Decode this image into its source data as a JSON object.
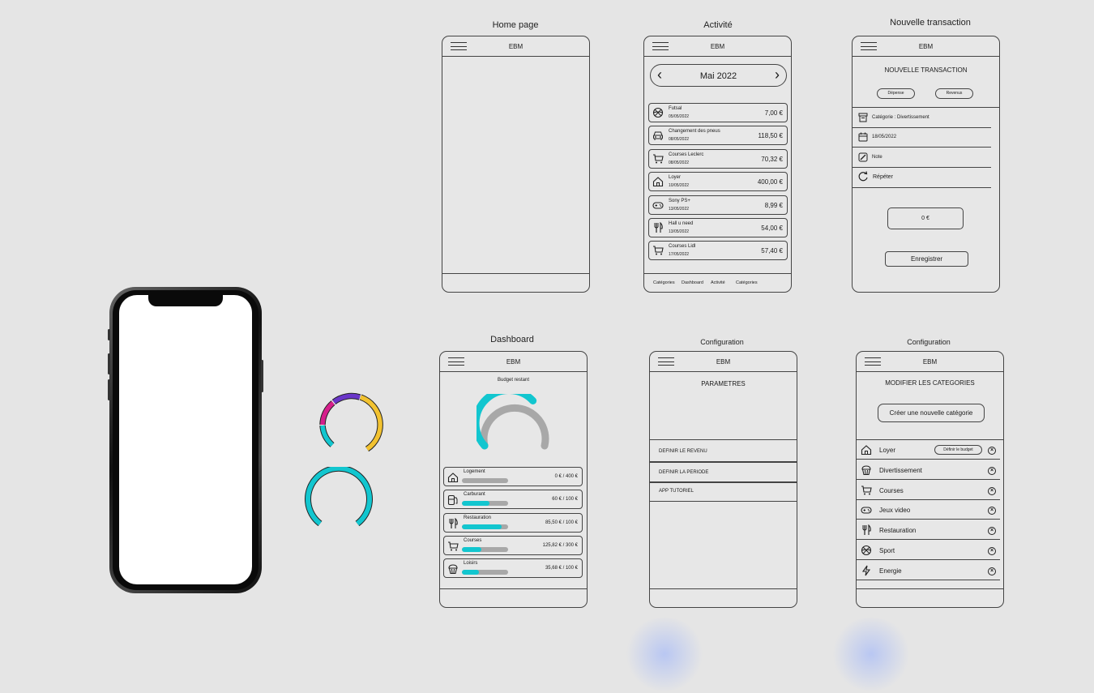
{
  "titles": {
    "home": "Home page",
    "activite": "Activité",
    "transaction": "Nouvelle transaction",
    "dashboard": "Dashboard",
    "config1": "Configuration",
    "config2": "Configuration"
  },
  "app_name": "EBM",
  "activity": {
    "month": "Mai 2022",
    "items": [
      {
        "icon": "basketball-icon",
        "name": "Futsal",
        "date": "05/05/2022",
        "amount": "7,00 €"
      },
      {
        "icon": "car-icon",
        "name": "Changement des pneus",
        "date": "08/05/2022",
        "amount": "118,50 €"
      },
      {
        "icon": "cart-icon",
        "name": "Courses Leclerc",
        "date": "08/05/2022",
        "amount": "70,32 €"
      },
      {
        "icon": "house-icon",
        "name": "Loyer",
        "date": "10/05/2022",
        "amount": "400,00 €"
      },
      {
        "icon": "gamepad-icon",
        "name": "Sony PS+",
        "date": "13/05/2022",
        "amount": "8,99 €"
      },
      {
        "icon": "cutlery-icon",
        "name": "Hall u need",
        "date": "13/05/2022",
        "amount": "54,00 €"
      },
      {
        "icon": "cart-icon",
        "name": "Courses Lidl",
        "date": "17/05/2022",
        "amount": "57,40 €"
      }
    ],
    "nav": [
      "Catégories",
      "Dashboard",
      "Activité",
      "Catégories"
    ]
  },
  "transaction": {
    "heading": "NOUVELLE TRANSACTION",
    "type_expense": "Dépense",
    "type_income": "Revenus",
    "category": "Catégorie : Divertissement",
    "date": "18/05/2022",
    "note": "Note",
    "repeat": "Répéter",
    "amount": "0 €",
    "save": "Enregistrer"
  },
  "dashboard": {
    "budget_label": "Budget restant",
    "gauge_fraction": 0.55,
    "accent": "#12c6cf",
    "items": [
      {
        "icon": "house-icon",
        "name": "Logement",
        "value": "0 €  /  400 €",
        "fraction": 0.0
      },
      {
        "icon": "fuel-icon",
        "name": "Carburant",
        "value": "60 €  /  100 €",
        "fraction": 0.6
      },
      {
        "icon": "cutlery-icon",
        "name": "Restauration",
        "value": "85,50 €  /  100 €",
        "fraction": 0.855
      },
      {
        "icon": "cart-icon",
        "name": "Courses",
        "value": "125,82 €  /  300 €",
        "fraction": 0.42
      },
      {
        "icon": "cupcake-icon",
        "name": "Loisirs",
        "value": "35,68 €  /  100 €",
        "fraction": 0.36
      }
    ]
  },
  "settings": {
    "heading": "PARAMETRES",
    "items": [
      "DEFINIR LE REVENU",
      "DEFINIR LA PERIODE",
      "APP TUTORIEL"
    ]
  },
  "categories": {
    "heading": "MODIFIER LES CATEGORIES",
    "create": "Créer une nouvelle catégorie",
    "define_budget": "Définir le budget",
    "items": [
      {
        "icon": "house-icon",
        "name": "Loyer"
      },
      {
        "icon": "cupcake-icon",
        "name": "Divertissement"
      },
      {
        "icon": "cart-icon",
        "name": "Courses"
      },
      {
        "icon": "gamepad-icon",
        "name": "Jeux video"
      },
      {
        "icon": "cutlery-icon",
        "name": "Restauration"
      },
      {
        "icon": "basketball-icon",
        "name": "Sport"
      },
      {
        "icon": "bolt-icon",
        "name": "Energie"
      }
    ]
  },
  "ring_colors": [
    "#d61f8c",
    "#6a36c9",
    "#f2c230",
    "#12c6cf"
  ]
}
